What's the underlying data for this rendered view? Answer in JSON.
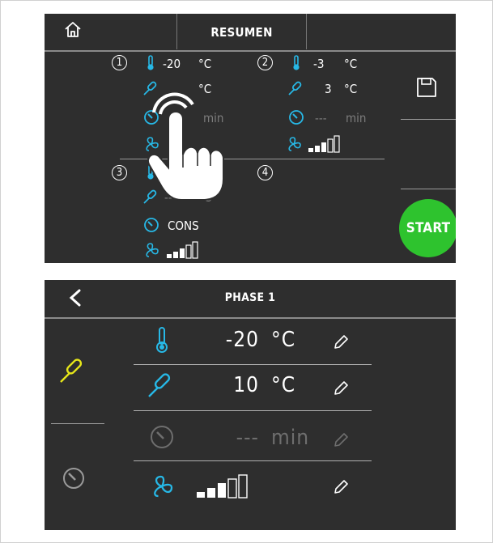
{
  "resumen": {
    "title": "RESUMEN",
    "phases": [
      {
        "num": "1",
        "temp": "-20",
        "temp_unit": "°C",
        "probe_unit": "°C",
        "time_unit": "min"
      },
      {
        "num": "2",
        "temp": "-3",
        "temp_unit": "°C",
        "probe": "3",
        "probe_unit": "°C",
        "time": "---",
        "time_unit": "min"
      },
      {
        "num": "3",
        "probe": "---",
        "probe_unit": "°C",
        "time": "CONS"
      },
      {
        "num": "4"
      }
    ],
    "start_label": "START"
  },
  "phase_detail": {
    "title": "PHASE 1",
    "rows": [
      {
        "value": "-20",
        "unit": "°C"
      },
      {
        "value": "10",
        "unit": "°C"
      },
      {
        "value": "---",
        "unit": "min"
      }
    ]
  },
  "colors": {
    "background": "#2e2e2e",
    "accent_blue": "#27b8e6",
    "accent_yellow": "#e6e619",
    "start_green": "#2ec32e",
    "dimmed": "#7c7c7c"
  },
  "icons": [
    "home-icon",
    "thermometer-icon",
    "probe-icon",
    "clock-icon",
    "fan-icon",
    "save-icon",
    "back-icon",
    "pencil-icon",
    "tap-hand-icon"
  ]
}
